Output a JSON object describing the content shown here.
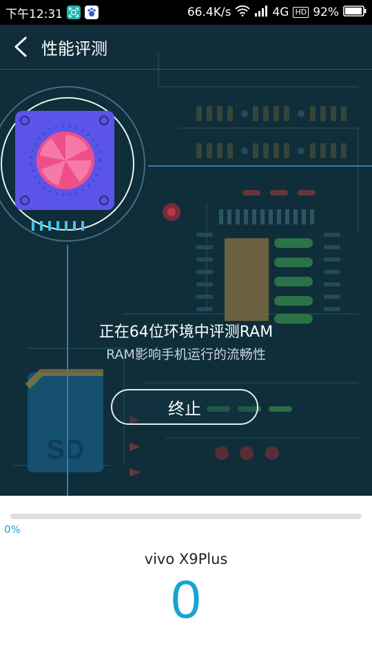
{
  "status_bar": {
    "time": "下午12:31",
    "speed": "66.4K/s",
    "network": "4G",
    "hd": "HD",
    "battery": "92%"
  },
  "nav": {
    "title": "性能评测",
    "back_icon": "chevron-left-icon"
  },
  "test": {
    "title": "正在64位环境中评测RAM",
    "subtitle": "RAM影响手机运行的流畅性",
    "stop_label": "终止"
  },
  "progress": {
    "value": 0,
    "label": "0%"
  },
  "device": {
    "name": "vivo X9Plus",
    "score": "0"
  },
  "colors": {
    "accent": "#19a3d4",
    "hero_bg": "#0f2e3a",
    "chip_blue": "#5b54e8",
    "dial_pink": "#ee4f8b"
  }
}
